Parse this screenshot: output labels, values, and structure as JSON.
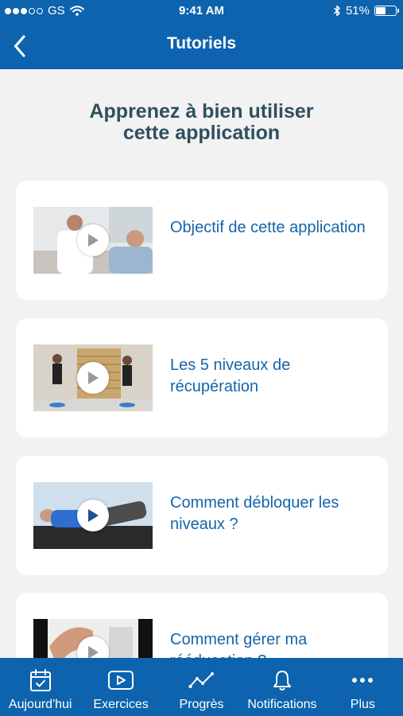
{
  "status_bar": {
    "carrier": "GS",
    "time": "9:41 AM",
    "battery": "51%",
    "battery_level": 0.51
  },
  "nav": {
    "title": "Tutoriels",
    "back_icon": "chevron-left-icon"
  },
  "heading": {
    "line1": "Apprenez à bien utiliser",
    "line2": "cette application"
  },
  "tutorials": [
    {
      "title": "Objectif de cette application",
      "icon": "play-icon"
    },
    {
      "title": "Les 5 niveaux de récupération",
      "icon": "play-icon"
    },
    {
      "title": "Comment débloquer les niveaux ?",
      "icon": "play-icon"
    },
    {
      "title": "Comment gérer ma rééducation ?",
      "icon": "play-icon"
    }
  ],
  "tabs": [
    {
      "label": "Aujourd'hui",
      "icon": "calendar-check-icon"
    },
    {
      "label": "Exercices",
      "icon": "video-play-icon"
    },
    {
      "label": "Progrès",
      "icon": "trend-line-icon"
    },
    {
      "label": "Notifications",
      "icon": "bell-icon"
    },
    {
      "label": "Plus",
      "icon": "more-dots-icon"
    }
  ],
  "colors": {
    "primary": "#0d63ad",
    "background": "#f2f2f2",
    "card": "#ffffff",
    "heading_text": "#2f4f5f",
    "link_text": "#1565a9"
  }
}
